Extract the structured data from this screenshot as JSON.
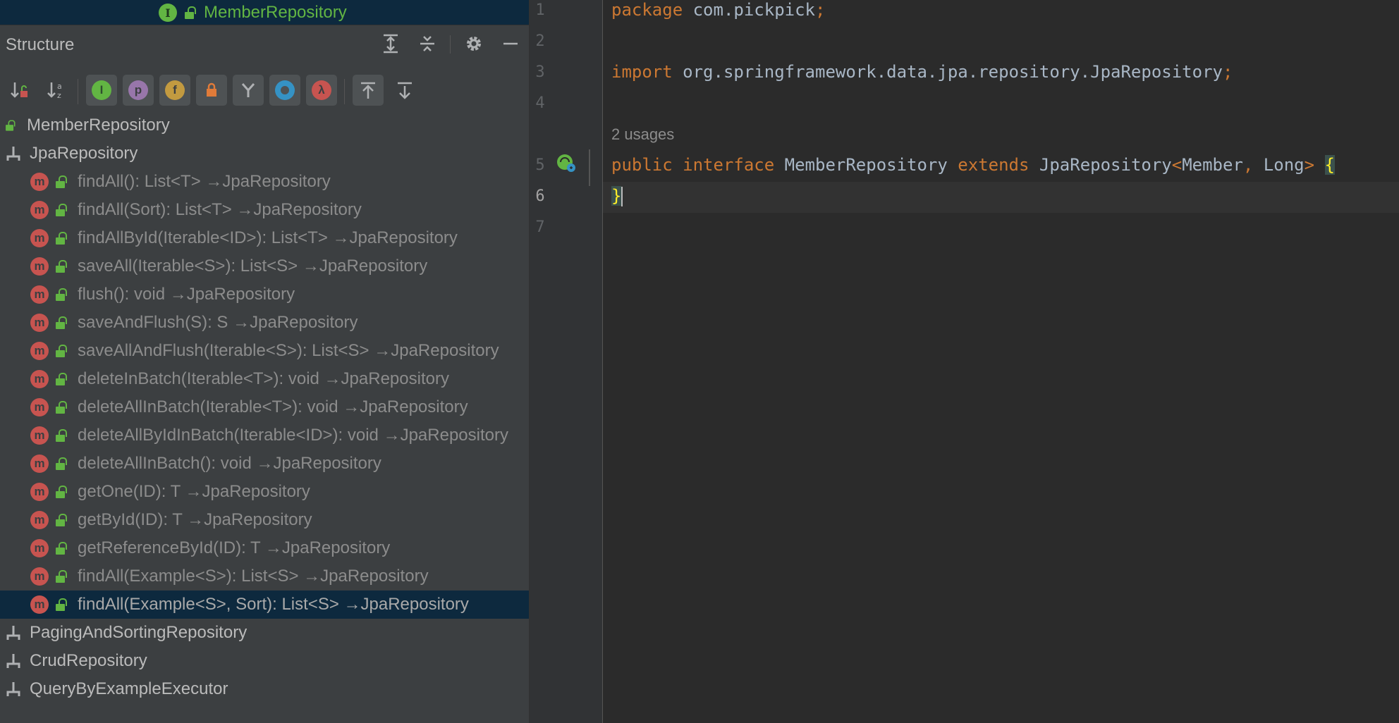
{
  "nav_bar": {
    "label": "MemberRepository",
    "badge": "I"
  },
  "panel": {
    "title": "Structure",
    "header_tools": [
      "expand-all-icon",
      "collapse-all-icon",
      "gear-icon",
      "minimize-icon"
    ]
  },
  "toolbar": {
    "sort_visibility": "sort-by-visibility-icon",
    "sort_alpha": "sort-alphabetically-icon",
    "inherited": "I",
    "properties": "p",
    "fields": "f",
    "non_public": "non-public-icon",
    "hierarchy": "hierarchy-icon",
    "anonymous": "anonymous-classes-icon",
    "lambdas": "λ",
    "autoscroll_to_source": "autoscroll-to-source-icon",
    "autoscroll_from_source": "autoscroll-from-source-icon"
  },
  "tree": {
    "root": "MemberRepository",
    "parent": "JpaRepository",
    "members": [
      "findAll(): List<T> →JpaRepository",
      "findAll(Sort): List<T> →JpaRepository",
      "findAllById(Iterable<ID>): List<T> →JpaRepository",
      "saveAll(Iterable<S>): List<S> →JpaRepository",
      "flush(): void →JpaRepository",
      "saveAndFlush(S): S →JpaRepository",
      "saveAllAndFlush(Iterable<S>): List<S> →JpaRepository",
      "deleteInBatch(Iterable<T>): void →JpaRepository",
      "deleteAllInBatch(Iterable<T>): void →JpaRepository",
      "deleteAllByIdInBatch(Iterable<ID>): void →JpaRepository",
      "deleteAllInBatch(): void →JpaRepository",
      "getOne(ID): T →JpaRepository",
      "getById(ID): T →JpaRepository",
      "getReferenceById(ID): T →JpaRepository",
      "findAll(Example<S>): List<S> →JpaRepository",
      "findAll(Example<S>, Sort): List<S> →JpaRepository"
    ],
    "member_badge": "m",
    "other_parents": [
      "PagingAndSortingRepository",
      "CrudRepository",
      "QueryByExampleExecutor"
    ]
  },
  "editor": {
    "line_numbers": [
      "1",
      "2",
      "3",
      "4",
      "5",
      "6",
      "7"
    ],
    "current_line": "6",
    "usages_hint": "2 usages",
    "line1": {
      "kw": "package",
      "rest": " com.pickpick",
      "semi": ";"
    },
    "line3": {
      "kw": "import",
      "rest": " org.springframework.data.jpa.repository.JpaRepository",
      "semi": ";"
    },
    "line5": {
      "kw1": "public",
      "kw2": "interface",
      "name": "MemberRepository",
      "kw3": "extends",
      "super": "JpaRepository",
      "lt": "<",
      "t1": "Member",
      "comma": ",",
      "t2": " Long",
      "gt": ">",
      "brace": "{"
    },
    "line6": {
      "brace": "}"
    }
  },
  "colors": {
    "keyword": "#cc7832",
    "text": "#a9b7c6",
    "selection": "#0d293e",
    "interface_green": "#62b543",
    "method_red": "#c75450"
  }
}
